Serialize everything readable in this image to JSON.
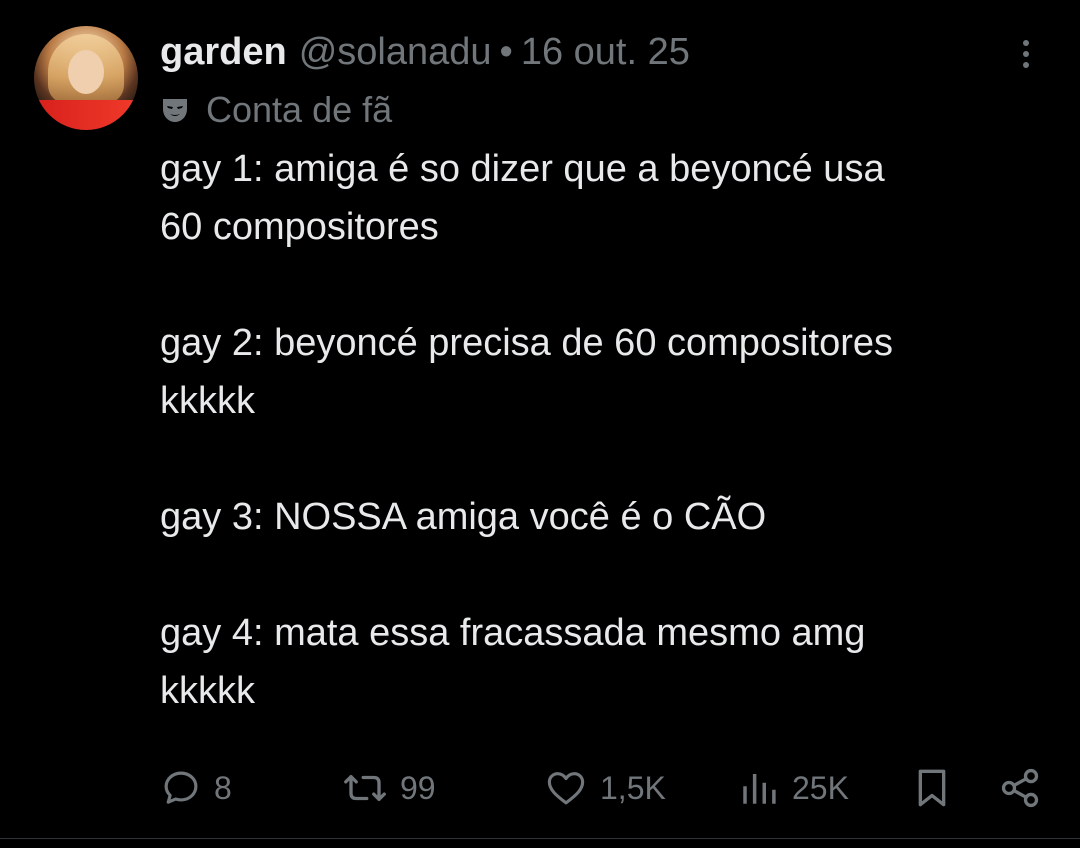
{
  "tweet": {
    "display_name": "garden",
    "handle": "@solanadu",
    "separator": "•",
    "date": "16 out. 25",
    "badge_icon": "mask-icon",
    "badge_label": "Conta de fã",
    "more_icon": "more-vertical-icon",
    "paragraphs": [
      [
        "gay 1: amiga é so dizer que a beyoncé usa",
        "60 compositores"
      ],
      [
        "gay 2: beyoncé precisa de 60 compositores",
        "kkkkk"
      ],
      [
        "gay 3: NOSSA amiga você é o CÃO"
      ],
      [
        "gay 4: mata essa fracassada mesmo amg",
        "kkkkk"
      ]
    ]
  },
  "actions": {
    "reply": {
      "icon": "reply-icon",
      "count": "8"
    },
    "retweet": {
      "icon": "retweet-icon",
      "count": "99"
    },
    "like": {
      "icon": "heart-icon",
      "count": "1,5K"
    },
    "views": {
      "icon": "views-icon",
      "count": "25K"
    },
    "bookmark": {
      "icon": "bookmark-icon"
    },
    "share": {
      "icon": "share-icon"
    }
  },
  "colors": {
    "background": "#000000",
    "text": "#e7e9ea",
    "secondary": "#71767b"
  }
}
